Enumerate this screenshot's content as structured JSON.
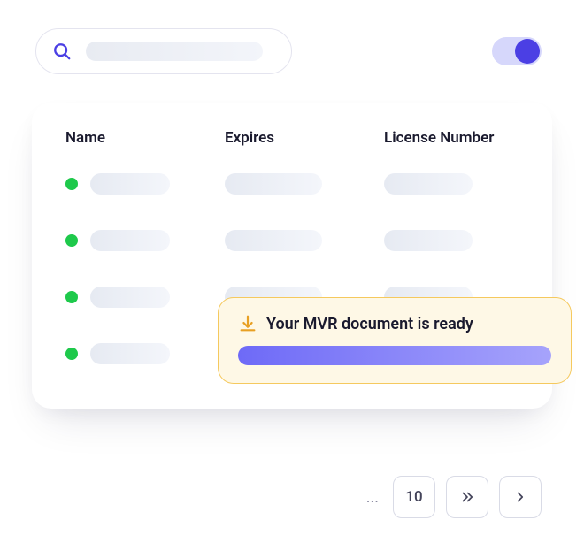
{
  "search": {
    "placeholder": ""
  },
  "toggle": {
    "on": true
  },
  "table": {
    "columns": {
      "name": "Name",
      "expires": "Expires",
      "license": "License Number"
    },
    "rows": [
      {
        "status": "green"
      },
      {
        "status": "green"
      },
      {
        "status": "green"
      },
      {
        "status": "green"
      }
    ]
  },
  "toast": {
    "icon": "download-icon",
    "title": "Your MVR document is ready",
    "progress": 100
  },
  "pagination": {
    "ellipsis": "...",
    "current": "10",
    "next": "»",
    "forward": "›"
  },
  "colors": {
    "accent": "#4b3fe4",
    "toggleTrack": "#d6d7fb",
    "statusGreen": "#1ec94b",
    "toastBg": "#fef8e6",
    "toastBorder": "#f5c95e",
    "progress": "#6e6af7"
  }
}
